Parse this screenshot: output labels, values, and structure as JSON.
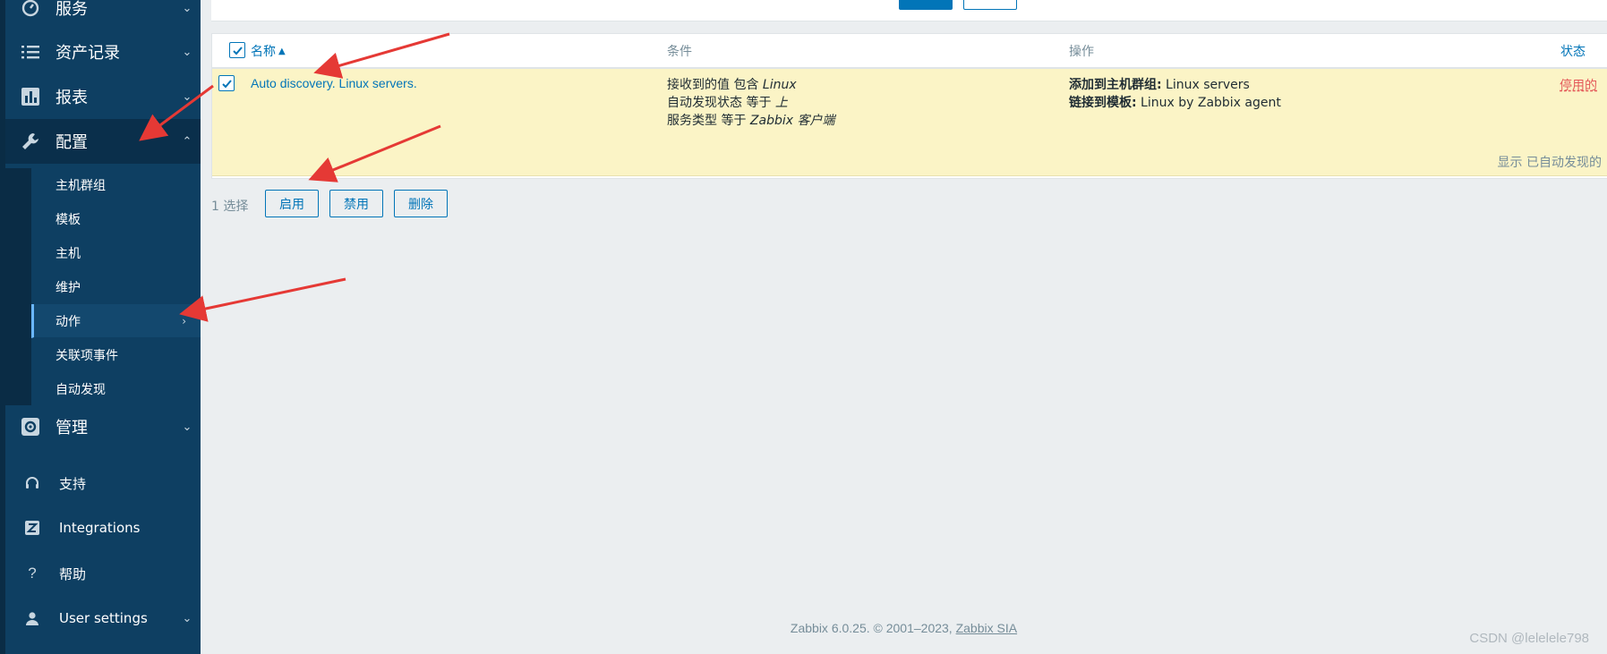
{
  "sidebar": {
    "nav": [
      {
        "label": "服务",
        "icon": "services-icon"
      },
      {
        "label": "资产记录",
        "icon": "list-icon"
      },
      {
        "label": "报表",
        "icon": "bar-chart-icon"
      },
      {
        "label": "配置",
        "icon": "wrench-icon"
      },
      {
        "label": "管理",
        "icon": "gear-icon"
      }
    ],
    "config_submenu": [
      "主机群组",
      "模板",
      "主机",
      "维护",
      "动作",
      "关联项事件",
      "自动发现"
    ],
    "footer": [
      {
        "label": "支持",
        "icon": "headset-icon"
      },
      {
        "label": "Integrations",
        "icon": "zabbix-z-icon"
      },
      {
        "label": "帮助",
        "icon": "question-icon"
      },
      {
        "label": "User settings",
        "icon": "user-icon"
      }
    ]
  },
  "table": {
    "headers": {
      "name": "名称",
      "conditions": "条件",
      "operations": "操作",
      "status": "状态"
    },
    "row": {
      "name": "Auto discovery. Linux servers.",
      "conditions": [
        {
          "prefix": "接收到的值 包含 ",
          "value": "Linux"
        },
        {
          "prefix": "自动发现状态 等于 ",
          "value": "上"
        },
        {
          "prefix": "服务类型 等于 ",
          "value": "Zabbix 客户端"
        }
      ],
      "operations": [
        {
          "label": "添加到主机群组:",
          "value": " Linux servers"
        },
        {
          "label": "链接到模板:",
          "value": " Linux by Zabbix agent"
        }
      ],
      "status": "停用的"
    },
    "paging": "显示 已自动发现的"
  },
  "actions": {
    "selected": "1 选择",
    "enable": "启用",
    "disable": "禁用",
    "delete": "删除"
  },
  "footer": {
    "text": "Zabbix 6.0.25. © 2001–2023, ",
    "company": "Zabbix SIA"
  },
  "watermark": "CSDN @lelelele798",
  "colors": {
    "accent": "#0275b8",
    "sidebar": "#0e3f62",
    "row_highlight": "#fbf4c6",
    "status_disabled": "#e45959",
    "annotation_arrow": "#e53935"
  }
}
